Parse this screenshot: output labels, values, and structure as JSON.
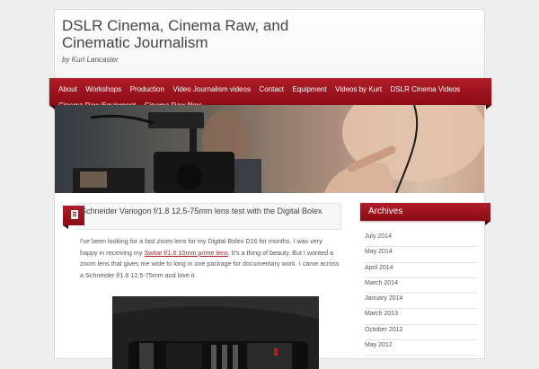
{
  "site": {
    "title": "DSLR Cinema, Cinema Raw, and Cinematic Journalism",
    "description": "by Kurt Lancaster"
  },
  "nav": {
    "items": [
      "About",
      "Workshops",
      "Production",
      "Video Journalism videos",
      "Contact",
      "Equipment",
      "Videos by Kurt",
      "DSLR Cinema Videos",
      "Cinema Raw Equipment",
      "Cinema Raw films"
    ]
  },
  "post": {
    "title": "Schneider Variogon f/1.8 12.5-75mm lens test with the Digital Bolex",
    "body_before_link": "I've been looking for a fast zoom lens for my Digital Bolex D16 for months. I was very happy in receiving my ",
    "link_text": "Switar f/1.6 10mm prime lens",
    "body_after_link": ". It's a thing of beauty. But I wanted a zoom lens that gives me wide to long in one package for documentary work. I came across a Schneider f/1.8 12.5-75mm and love it."
  },
  "sidebar": {
    "widget_title": "Archives",
    "archives": [
      "July 2014",
      "May 2014",
      "April 2014",
      "March 2014",
      "January 2014",
      "March 2013",
      "October 2012",
      "May 2012"
    ]
  },
  "colors": {
    "accent": "#9d1420",
    "link": "#b01c28"
  }
}
